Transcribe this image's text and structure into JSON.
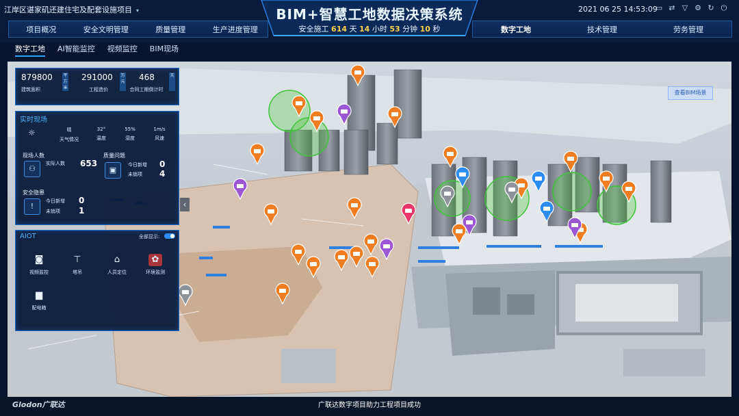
{
  "header": {
    "project": "江岸区谌家矶还建住宅及配套设施项目",
    "title": "BIM+智慧工地数据决策系统",
    "countdown": {
      "prefix": "安全施工",
      "days": "614",
      "days_unit": "天",
      "hours": "14",
      "hours_unit": "小时",
      "minutes": "53",
      "minutes_unit": "分钟",
      "seconds": "10",
      "seconds_unit": "秒"
    },
    "datetime": "2021  06  25  14:53:09",
    "tool_icons": [
      "monitor-icon",
      "sync-icon",
      "tshirt-icon",
      "settings-icon",
      "refresh-icon",
      "power-icon"
    ]
  },
  "nav_left": [
    "项目概况",
    "安全文明管理",
    "质量管理",
    "生产进度管理"
  ],
  "nav_right": [
    "数字工地",
    "技术管理",
    "劳务管理"
  ],
  "subtabs": [
    "数字工地",
    "AI智能监控",
    "视频监控",
    "BIM现场"
  ],
  "stats": [
    {
      "value": "879800",
      "unit": "平方米",
      "label": "建筑面积"
    },
    {
      "value": "291000",
      "unit": "万元",
      "label": "工程造价"
    },
    {
      "value": "468",
      "unit": "天",
      "label": "合同工期倒计时"
    }
  ],
  "live": {
    "title": "实时现场",
    "weather": {
      "icon": "sun-icon",
      "condition": "晴",
      "condition_label": "天气情况",
      "temp": "32°",
      "temp_label": "温度",
      "humidity": "55%",
      "humidity_label": "湿度",
      "wind": "1m/s",
      "wind_label": "风速"
    },
    "people": {
      "title": "现场人数",
      "label": "实际人数",
      "value": "653"
    },
    "quality": {
      "title": "质量问题",
      "new_label": "今日新增",
      "new": "0",
      "open_label": "未销项",
      "open": "4"
    },
    "safety": {
      "title": "安全隐患",
      "new_label": "今日新增",
      "new": "0",
      "open_label": "未销项",
      "open": "1"
    }
  },
  "aiot": {
    "title": "AIOT",
    "toggle_label": "全部显示:",
    "items": [
      {
        "name": "视频监控",
        "icon": "camera-icon"
      },
      {
        "name": "塔吊",
        "icon": "crane-icon"
      },
      {
        "name": "人员定位",
        "icon": "location-icon"
      },
      {
        "name": "环境监测",
        "icon": "environment-icon"
      },
      {
        "name": "配电箱",
        "icon": "power-box-icon"
      }
    ]
  },
  "scene": {
    "view_toggle": "查看BIM场景"
  },
  "footer": {
    "logo": "Glodon广联达",
    "caption": "广联达数字项目助力工程项目成功"
  },
  "colors": {
    "accent": "#2fa2ff",
    "highlight": "#ffd24a",
    "camera_marker": "#f07d22",
    "env_marker": "#9b57d3",
    "blue_marker": "#2c8cf0",
    "gray_marker": "#8e939a",
    "alert_marker": "#e8356a"
  }
}
